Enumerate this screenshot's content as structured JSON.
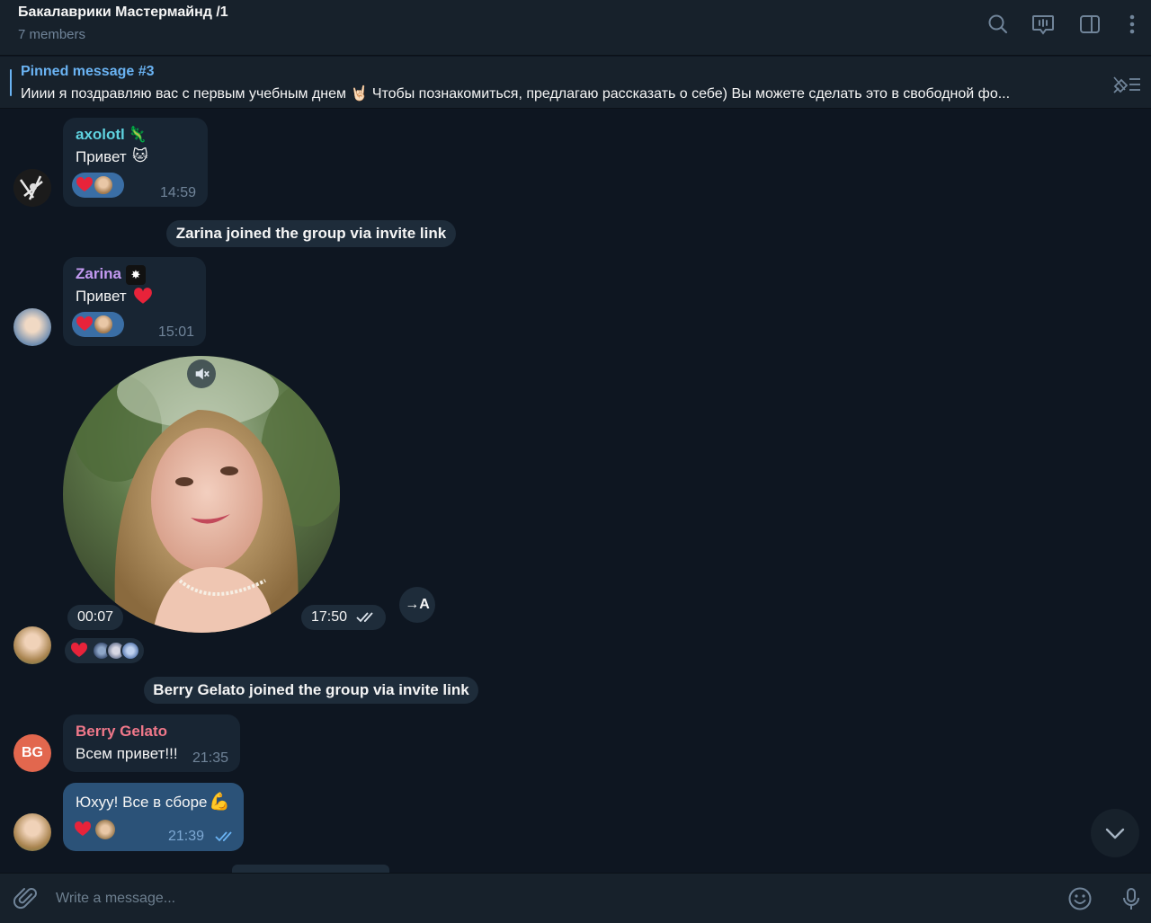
{
  "header": {
    "title": "Бакалаврики Мастермайнд /1",
    "subtitle": "7 members",
    "icons": [
      "search-icon",
      "video-chat-icon",
      "sidebar-toggle-icon",
      "more-icon"
    ]
  },
  "pinned": {
    "title": "Pinned message #3",
    "text": "Ииии я поздравляю вас с первым учебным днем 🤘🏻  Чтобы познакомиться, предлагаю рассказать о себе) Вы можете сделать это в свободной фо..."
  },
  "messages": [
    {
      "sender": "axolotl",
      "sender_color": "#5fd3e0",
      "text": "Привет",
      "time": "14:59"
    },
    {
      "sender": "Zarina",
      "sender_color": "#c49af2",
      "text": "Привет",
      "time": "15:01"
    },
    {
      "type": "video",
      "duration": "00:07",
      "time": "17:50"
    },
    {
      "sender": "Berry Gelato",
      "sender_color": "#f0788a",
      "text": "Всем привет!!!",
      "time": "21:35",
      "avatar_initials": "BG"
    },
    {
      "outgoing": true,
      "text": "Юхуу! Все в сборе",
      "time": "21:39"
    }
  ],
  "service": [
    "Zarina joined the group via invite link",
    "Berry Gelato joined the group via invite link"
  ],
  "translate_label": "→A",
  "composer": {
    "placeholder": "Write a message..."
  },
  "colors": {
    "accent": "#6ab3f3",
    "bg": "#0e1621",
    "panel": "#17212b",
    "bubble_in": "#182533",
    "bubble_out": "#2b5278",
    "reaction_bg": "#3a6ea5"
  }
}
